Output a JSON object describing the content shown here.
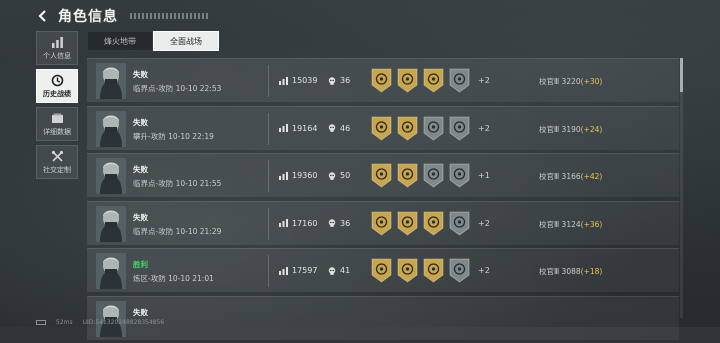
{
  "header": {
    "title": "角色信息"
  },
  "sidebar": {
    "items": [
      {
        "label": "个人信息",
        "icon": "bar-chart-icon",
        "active": false
      },
      {
        "label": "历史战绩",
        "icon": "clock-icon",
        "active": true
      },
      {
        "label": "详细数据",
        "icon": "folder-icon",
        "active": false
      },
      {
        "label": "社交定制",
        "icon": "tools-icon",
        "active": false
      }
    ]
  },
  "tabs": [
    {
      "label": "烽火地带",
      "active": false
    },
    {
      "label": "全面战场",
      "active": true
    }
  ],
  "matches": [
    {
      "result": "失败",
      "win": false,
      "map": "临界点-攻防 10-10 22:53",
      "score": "15039",
      "kills": "36",
      "more": "+2",
      "rank": "校官Ⅲ 3220",
      "delta": "(+30)"
    },
    {
      "result": "失败",
      "win": false,
      "map": "攀升-攻防 10-10 22:19",
      "score": "19164",
      "kills": "46",
      "more": "+2",
      "rank": "校官Ⅲ 3190",
      "delta": "(+24)"
    },
    {
      "result": "失败",
      "win": false,
      "map": "临界点-攻防 10-10 21:55",
      "score": "19360",
      "kills": "50",
      "more": "+1",
      "rank": "校官Ⅲ 3166",
      "delta": "(+42)"
    },
    {
      "result": "失败",
      "win": false,
      "map": "临界点-攻防 10-10 21:29",
      "score": "17160",
      "kills": "36",
      "more": "+2",
      "rank": "校官Ⅲ 3124",
      "delta": "(+36)"
    },
    {
      "result": "胜利",
      "win": true,
      "map": "炼区-攻防 10-10 21:01",
      "score": "17597",
      "kills": "41",
      "more": "+2",
      "rank": "校官Ⅲ 3088",
      "delta": "(+18)"
    },
    {
      "result": "失败",
      "win": false,
      "map": "",
      "score": "",
      "kills": "",
      "more": "",
      "rank": "",
      "delta": ""
    }
  ],
  "footer": {
    "ping": "52ms",
    "uid": "UID:541320248828354856"
  },
  "colors": {
    "win": "#44d46a",
    "delta": "#e8c35a",
    "medal_gold": "#c9a64a",
    "medal_steel": "#7d8a8c"
  }
}
